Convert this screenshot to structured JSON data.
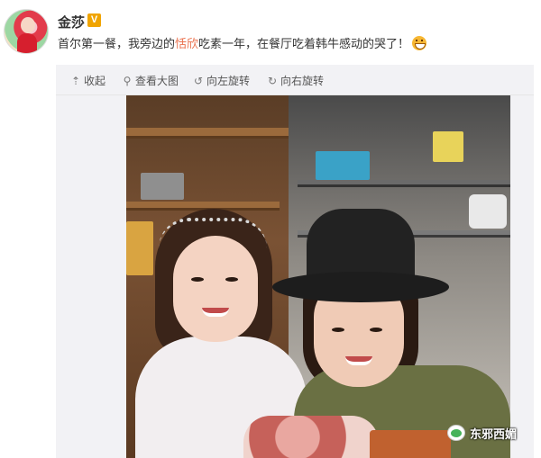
{
  "post": {
    "username": "金莎",
    "verified_badge": "V",
    "text_before": "首尔第一餐，我旁边的",
    "text_highlight": "恬欣",
    "text_after": "吃素一年，在餐厅吃着韩牛感动的哭了！",
    "emoji": "laughing-emoji",
    "highlight_color": "#eb7350"
  },
  "toolbar": {
    "collapse_label": "收起",
    "view_large_label": "查看大图",
    "rotate_left_label": "向左旋转",
    "rotate_right_label": "向右旋转",
    "icons": [
      "arrow-up-icon",
      "magnifier-icon",
      "rotate-left-icon",
      "rotate-right-icon"
    ]
  },
  "photo": {
    "subject": "two women posing in restaurant kitchen"
  },
  "watermark": {
    "text": "东邪西媚",
    "icon": "wechat-icon"
  }
}
